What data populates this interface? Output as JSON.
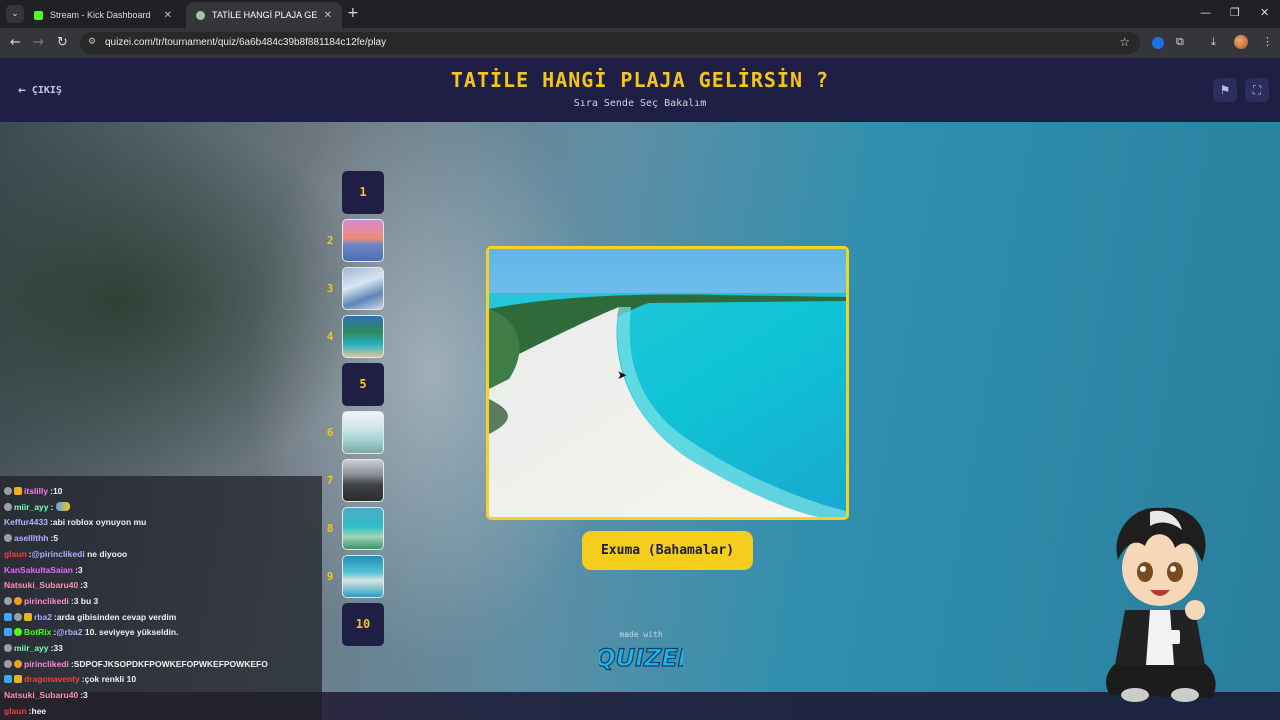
{
  "browser": {
    "tabs": [
      {
        "title": "Stream - Kick Dashboard",
        "active": false
      },
      {
        "title": "TATİLE HANGİ PLAJA GELİRSİN",
        "active": true
      }
    ],
    "url": "quizei.com/tr/tournament/quiz/6a6b484c39b8f881184c12fe/play"
  },
  "header": {
    "exit_label": "ÇIKIŞ",
    "title": "TATİLE HANGİ PLAJA GELİRSİN ?",
    "subtitle": "Sıra Sende Seç Bakalım"
  },
  "steps": [
    {
      "number": "1",
      "thumb": "none"
    },
    {
      "number": "2",
      "thumb": "sunset-beach"
    },
    {
      "number": "3",
      "thumb": "shoreline"
    },
    {
      "number": "4",
      "thumb": "palm-beach"
    },
    {
      "number": "5",
      "thumb": "none"
    },
    {
      "number": "6",
      "thumb": "cove"
    },
    {
      "number": "7",
      "thumb": "stormy-beach"
    },
    {
      "number": "8",
      "thumb": "bay"
    },
    {
      "number": "9",
      "thumb": "reef"
    },
    {
      "number": "10",
      "thumb": "none"
    }
  ],
  "current_choice": {
    "image": "exuma-beach-aerial",
    "label": "Exuma (Bahamalar)"
  },
  "footer": {
    "made_with": "made with",
    "logo_text": "QUIZEI"
  },
  "chat": [
    {
      "user": "itslilly",
      "color": "#ff7de9",
      "badges": [
        "sub",
        "gold"
      ],
      "text": "10"
    },
    {
      "user": "miir_ayy",
      "color": "#7dffb0",
      "badges": [
        "sub"
      ],
      "text": "",
      "emote": true
    },
    {
      "user": "Keffur4433",
      "color": "#a9b8ff",
      "badges": [],
      "text": "abi roblox oynuyon mu"
    },
    {
      "user": "aselllthh",
      "color": "#c3a8ff",
      "badges": [
        "sub"
      ],
      "text": "5"
    },
    {
      "user": "glaun",
      "color": "#ff3b3b",
      "badges": [],
      "mention": "@pirinclikedi",
      "text": "ne diyooo"
    },
    {
      "user": "KanSakultaSaian",
      "color": "#e06cff",
      "badges": [],
      "text": "3"
    },
    {
      "user": "Natsuki_Subaru40",
      "color": "#ff8fb0",
      "badges": [],
      "text": "3"
    },
    {
      "user": "pirinclikedi",
      "color": "#ff8ad1",
      "badges": [
        "sub",
        "orange"
      ],
      "text": "3 bu 3"
    },
    {
      "user": "rba2",
      "color": "#b7a2ff",
      "badges": [
        "mod",
        "sub",
        "gold"
      ],
      "text": "arda gibisinden cevap verdim"
    },
    {
      "user": "BotRix",
      "color": "#53fc18",
      "badges": [
        "mod",
        "green"
      ],
      "mention": "@rba2",
      "text": "10. seviyeye yükseldin."
    },
    {
      "user": "miir_ayy",
      "color": "#7dffb0",
      "badges": [
        "sub"
      ],
      "text": "33"
    },
    {
      "user": "pirinclikedi",
      "color": "#ff8ad1",
      "badges": [
        "sub",
        "orange"
      ],
      "text": "SDPOFJKSOPDKFPOWKEFOPWKEFPOWKEFO"
    },
    {
      "user": "dragonaventy",
      "color": "#ff3b3b",
      "badges": [
        "mod",
        "gold"
      ],
      "text": "çok renkli 10"
    },
    {
      "user": "Natsuki_Subaru40",
      "color": "#ff8fb0",
      "badges": [],
      "text": "3"
    },
    {
      "user": "glaun",
      "color": "#ff3b3b",
      "badges": [],
      "text": "hee"
    }
  ]
}
